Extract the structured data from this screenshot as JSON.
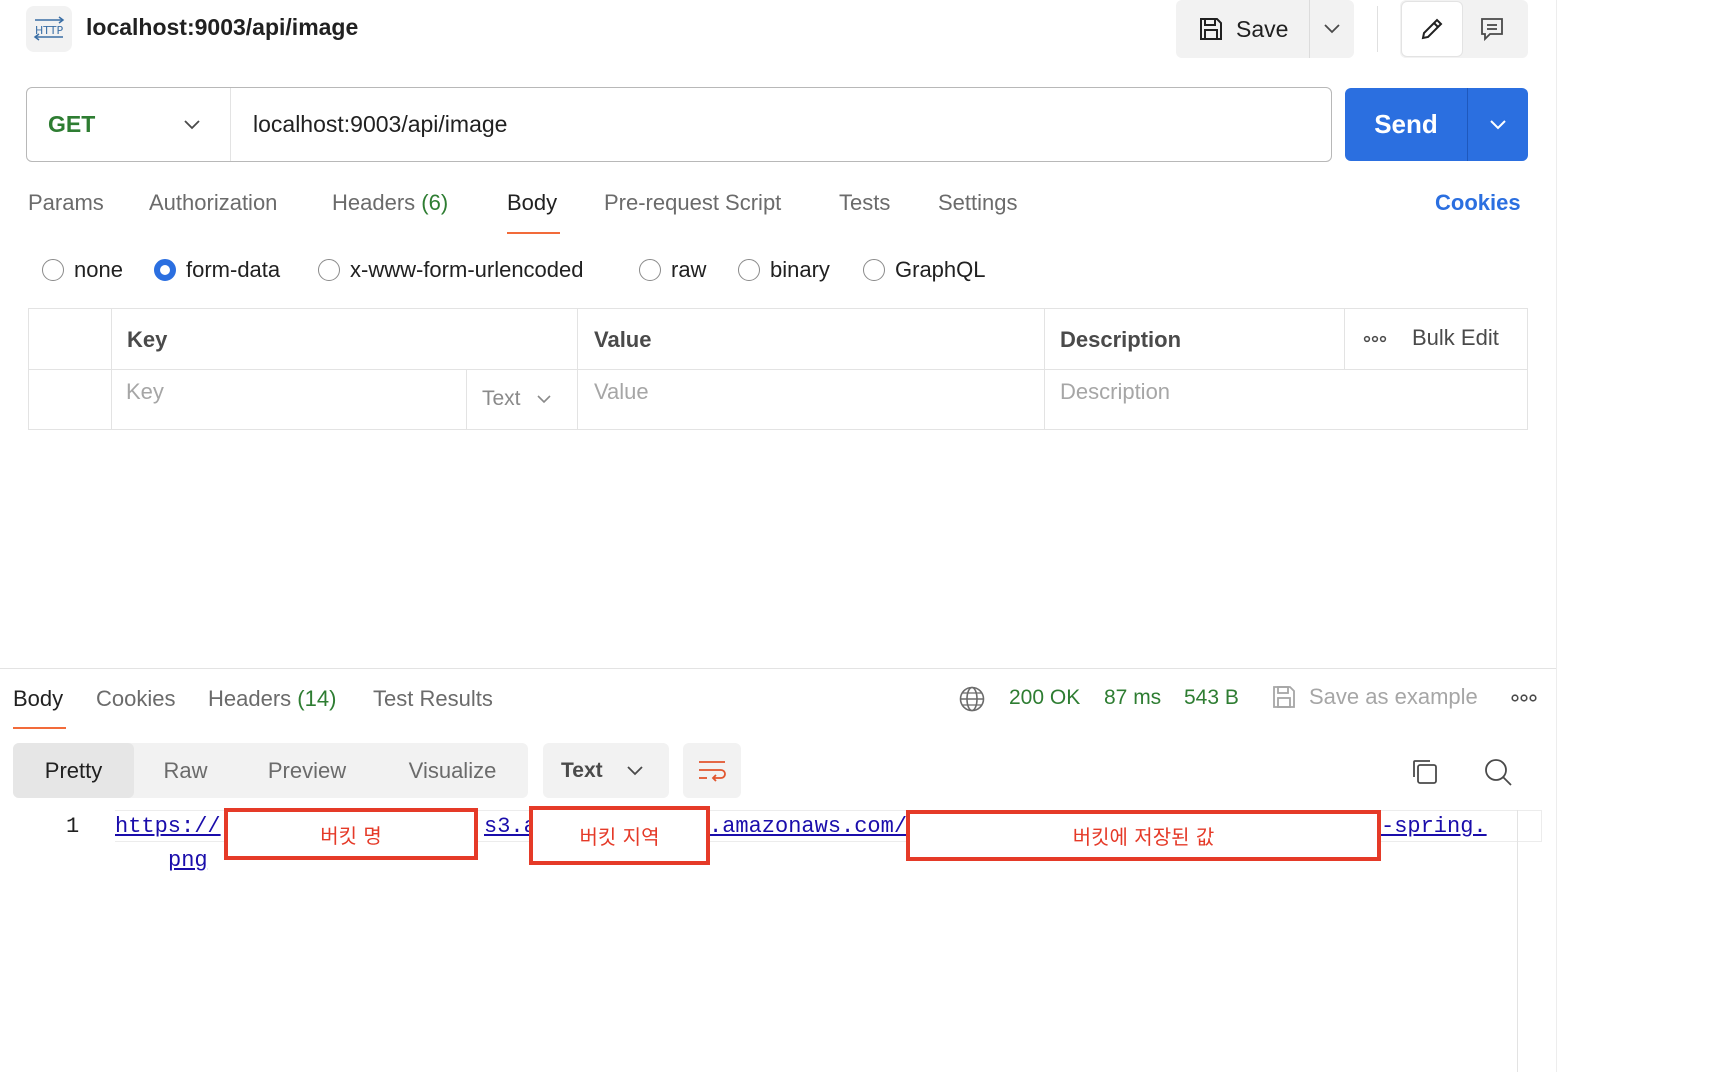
{
  "request": {
    "title": "localhost:9003/api/image",
    "method": "GET",
    "url": "localhost:9003/api/image"
  },
  "toolbar": {
    "save_label": "Save",
    "send_label": "Send"
  },
  "request_tabs": [
    {
      "label": "Params"
    },
    {
      "label": "Authorization"
    },
    {
      "label": "Headers",
      "count": "(6)"
    },
    {
      "label": "Body"
    },
    {
      "label": "Pre-request Script"
    },
    {
      "label": "Tests"
    },
    {
      "label": "Settings"
    }
  ],
  "cookies_label": "Cookies",
  "body_types": [
    {
      "label": "none",
      "checked": false
    },
    {
      "label": "form-data",
      "checked": true
    },
    {
      "label": "x-www-form-urlencoded",
      "checked": false
    },
    {
      "label": "raw",
      "checked": false
    },
    {
      "label": "binary",
      "checked": false
    },
    {
      "label": "GraphQL",
      "checked": false
    }
  ],
  "kv_table": {
    "headers": {
      "key": "Key",
      "value": "Value",
      "description": "Description"
    },
    "bulk_edit": "Bulk Edit",
    "row": {
      "key_placeholder": "Key",
      "type": "Text",
      "value_placeholder": "Value",
      "description_placeholder": "Description"
    }
  },
  "response_tabs": [
    {
      "label": "Body"
    },
    {
      "label": "Cookies"
    },
    {
      "label": "Headers",
      "count": "(14)"
    },
    {
      "label": "Test Results"
    }
  ],
  "status": {
    "code": "200 OK",
    "time": "87 ms",
    "size": "543 B"
  },
  "save_example_label": "Save as example",
  "view_modes": [
    "Pretty",
    "Raw",
    "Preview",
    "Visualize"
  ],
  "format": "Text",
  "code": {
    "line_number": "1",
    "seg1": "https://",
    "seg2": "s3.a",
    "seg3": ".amazonaws.com/",
    "seg4": "-spring.",
    "line2": "png"
  },
  "annotations": {
    "bucket_name": "버킷 명",
    "bucket_region": "버킷 지역",
    "bucket_value": "버킷에 저장된 값"
  },
  "colors": {
    "accent": "#2b6fe0",
    "success": "#2e7d32",
    "tab_underline": "#f26b3a",
    "annotation": "#e53a28"
  }
}
